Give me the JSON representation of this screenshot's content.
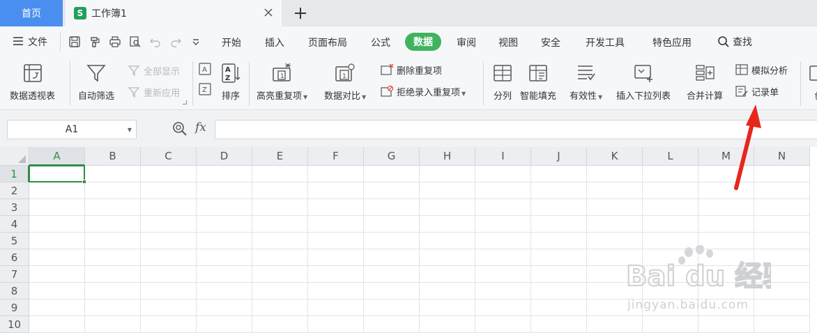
{
  "tabs": {
    "home_label": "首页",
    "doc_title": "工作簿1",
    "doc_icon_letter": "S",
    "close_icon": "close-icon",
    "add_icon": "plus-icon"
  },
  "menu": {
    "file_label": "文件",
    "tabs": [
      "开始",
      "插入",
      "页面布局",
      "公式",
      "数据",
      "审阅",
      "视图",
      "安全",
      "开发工具",
      "特色应用"
    ],
    "active_tab": "数据",
    "search_label": "查找"
  },
  "ribbon": {
    "pivot": "数据透视表",
    "autofilter": "自动筛选",
    "show_all": "全部显示",
    "reapply": "重新应用",
    "sort": "排序",
    "highlight_dup": "高亮重复项",
    "compare": "数据对比",
    "remove_dup": "删除重复项",
    "reject_dup": "拒绝录入重复项",
    "split": "分列",
    "smart_fill": "智能填充",
    "validity": "有效性",
    "insert_dropdown": "插入下拉列表",
    "consolidate": "合并计算",
    "what_if": "模拟分析",
    "record_form": "记录单",
    "create_partial": "创"
  },
  "formula": {
    "name_box": "A1",
    "fx_label": "fx",
    "value": ""
  },
  "grid": {
    "columns": [
      "A",
      "B",
      "C",
      "D",
      "E",
      "F",
      "G",
      "H",
      "I",
      "J",
      "K",
      "L",
      "M",
      "N"
    ],
    "rows": [
      "1",
      "2",
      "3",
      "4",
      "5",
      "6",
      "7",
      "8",
      "9",
      "10"
    ],
    "selected_column": "A",
    "selected_row": "1"
  },
  "colors": {
    "accent_green": "#41b35d",
    "cell_green": "#2f8d45",
    "home_tab_blue": "#4a8ff0",
    "arrow_red": "#e8261c"
  },
  "watermark": {
    "brand": "Bai du 经验",
    "url": "jingyan.baidu.com"
  }
}
